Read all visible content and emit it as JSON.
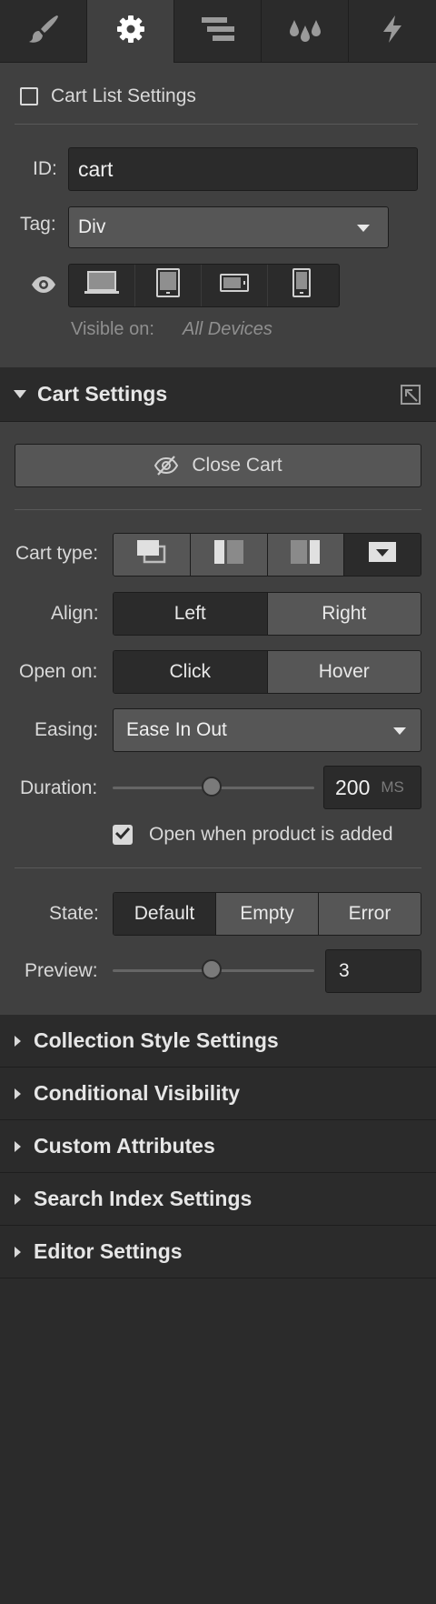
{
  "tabs": [
    {
      "name": "style",
      "icon": "paintbrush-icon",
      "active": false
    },
    {
      "name": "settings",
      "icon": "gear-icon",
      "active": true
    },
    {
      "name": "navigator",
      "icon": "layers-icon",
      "active": false
    },
    {
      "name": "swatches",
      "icon": "droplets-icon",
      "active": false
    },
    {
      "name": "interactions",
      "icon": "lightning-icon",
      "active": false
    }
  ],
  "element": {
    "checkbox_label": "Cart List Settings",
    "id_label": "ID:",
    "id_value": "cart",
    "tag_label": "Tag:",
    "tag_value": "Div",
    "visibility_icon": "eye-icon",
    "devices": [
      "desktop-icon",
      "tablet-icon",
      "mobile-landscape-icon",
      "mobile-portrait-icon"
    ],
    "visible_on_label": "Visible on:",
    "visible_on_value": "All Devices"
  },
  "cart_settings": {
    "title": "Cart Settings",
    "close_cart_label": "Close Cart",
    "cart_type_label": "Cart type:",
    "cart_types": [
      "modal-icon",
      "left-sidebar-icon",
      "right-sidebar-icon",
      "dropdown-icon"
    ],
    "cart_type_selected": 3,
    "align_label": "Align:",
    "align_options": [
      "Left",
      "Right"
    ],
    "align_selected": "Left",
    "open_on_label": "Open on:",
    "open_on_options": [
      "Click",
      "Hover"
    ],
    "open_on_selected": "Click",
    "easing_label": "Easing:",
    "easing_value": "Ease In Out",
    "duration_label": "Duration:",
    "duration_value": "200",
    "duration_unit": "MS",
    "open_when_added_label": "Open when product is added",
    "open_when_added_checked": true,
    "state_label": "State:",
    "state_options": [
      "Default",
      "Empty",
      "Error"
    ],
    "state_selected": "Default",
    "preview_label": "Preview:",
    "preview_value": "3"
  },
  "collapsed_sections": [
    "Collection Style Settings",
    "Conditional Visibility",
    "Custom Attributes",
    "Search Index Settings",
    "Editor Settings"
  ]
}
